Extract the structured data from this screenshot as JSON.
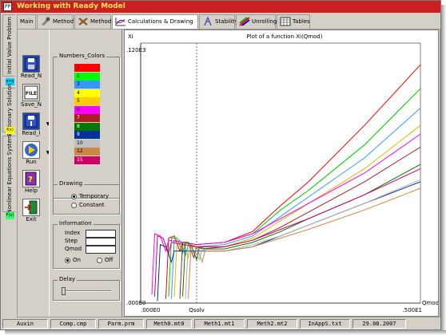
{
  "window": {
    "title": "Working with Ready Model",
    "icon_label": "PP"
  },
  "vertical_tabs": [
    {
      "label": "Initial Value Problem",
      "icon": "x-y-icon"
    },
    {
      "label": "Stationary Solution",
      "icon": "fx-icon"
    },
    {
      "label": "Nonlinear Equations System",
      "icon": "fx-matrix-icon"
    }
  ],
  "tabs": [
    {
      "label": "Main",
      "icon": ""
    },
    {
      "label": "Method1",
      "icon": "method1-icon"
    },
    {
      "label": "Method2",
      "icon": "method2-icon"
    },
    {
      "label": "Calculations & Drawing",
      "icon": "graph-icon",
      "active": true
    },
    {
      "label": "Stability",
      "icon": "stability-icon"
    },
    {
      "label": "Unrolling",
      "icon": "unrolling-icon"
    },
    {
      "label": "Tables",
      "icon": "tables-icon"
    }
  ],
  "toolbar": {
    "read_n": "Read_N",
    "save_n": "Save_N",
    "read_i": "Read_I",
    "run": "Run",
    "help": "Help",
    "exit": "Exit",
    "save_badge": "FILE"
  },
  "numbers_colors": {
    "title": "Numbers_Colors",
    "items": [
      {
        "label": "1",
        "color": "#ff0000"
      },
      {
        "label": "2",
        "color": "#00ff00"
      },
      {
        "label": "3",
        "color": "#3399ff"
      },
      {
        "label": "4",
        "color": "#ffff00"
      },
      {
        "label": "5",
        "color": "#ffcc00"
      },
      {
        "label": "6",
        "color": "#ff00ff"
      },
      {
        "label": "7",
        "color": "#aa2020"
      },
      {
        "label": "8",
        "color": "#007700"
      },
      {
        "label": "9",
        "color": "#003399"
      },
      {
        "label": "10",
        "color": "#c0c0c0"
      },
      {
        "label": "12",
        "color": "#cc8844"
      },
      {
        "label": "15",
        "color": "#cc0066"
      }
    ]
  },
  "drawing": {
    "title": "Drawing",
    "options": [
      "Temporary",
      "Constant"
    ],
    "selected": "Temporary"
  },
  "information": {
    "title": "Information",
    "fields": [
      {
        "label": "Index",
        "value": ""
      },
      {
        "label": "Step",
        "value": ""
      },
      {
        "label": "Qmod",
        "value": ""
      }
    ],
    "options": [
      "On",
      "Off"
    ],
    "selected": "On"
  },
  "delay": {
    "title": "Delay",
    "value": 0
  },
  "chart_data": {
    "type": "line",
    "title": "Plot of a function Xi(Qmod)",
    "ylabel": "Xi",
    "xlabel": "Qmod",
    "y_top_label": ".120E3",
    "y_bottom_label": ".000E0",
    "x_left_label": ".000E0",
    "x_right_label": ".500E1",
    "xlim": [
      0,
      5
    ],
    "ylim": [
      0,
      120
    ],
    "marker": {
      "label": "Qsolv",
      "x": 1.0
    },
    "grid": false,
    "series": [
      {
        "color": "#ff0000",
        "x": [
          0.45,
          0.5,
          0.6,
          0.7,
          0.75,
          1.0,
          1.5,
          2.0,
          2.5,
          3.0,
          4.0,
          5.0
        ],
        "y": [
          2,
          30,
          31,
          24,
          28,
          27,
          28,
          33,
          45,
          56,
          82,
          110
        ]
      },
      {
        "color": "#00cc00",
        "x": [
          0.5,
          0.55,
          0.65,
          0.75,
          0.8,
          1.0,
          1.5,
          2.0,
          2.5,
          3.0,
          4.0,
          5.0
        ],
        "y": [
          3,
          30,
          30,
          23,
          28,
          27,
          28,
          32,
          43,
          52,
          73,
          99
        ]
      },
      {
        "color": "#3399ff",
        "x": [
          0.55,
          0.6,
          0.7,
          0.8,
          0.85,
          1.0,
          1.5,
          2.0,
          2.5,
          3.0,
          4.0,
          5.0
        ],
        "y": [
          2,
          29,
          29,
          22,
          27,
          26,
          27,
          31,
          40,
          49,
          67,
          90
        ]
      },
      {
        "color": "#ddbb00",
        "x": [
          0.6,
          0.65,
          0.75,
          0.85,
          0.9,
          1.0,
          1.5,
          2.0,
          2.5,
          3.0,
          4.0,
          5.0
        ],
        "y": [
          3,
          29,
          28,
          21,
          27,
          26,
          26,
          30,
          38,
          46,
          62,
          82
        ]
      },
      {
        "color": "#ff00ff",
        "x": [
          0.2,
          0.25,
          0.35,
          0.45,
          0.5,
          1.0,
          1.5,
          2.0,
          2.5,
          3.0,
          4.0,
          5.0
        ],
        "y": [
          4,
          32,
          31,
          24,
          29,
          27,
          28,
          32,
          39,
          46,
          60,
          78
        ]
      },
      {
        "color": "#aa2020",
        "x": [
          0.7,
          0.75,
          0.85,
          0.95,
          1.0,
          1.1,
          1.5,
          2.0,
          2.5,
          3.0,
          4.0,
          5.0
        ],
        "y": [
          2,
          28,
          28,
          21,
          26,
          25,
          26,
          29,
          35,
          42,
          56,
          72
        ]
      },
      {
        "color": "#007700",
        "x": [
          0.75,
          0.8,
          0.9,
          1.0,
          1.05,
          1.15,
          1.5,
          2.0,
          2.5,
          3.0,
          4.0,
          5.0
        ],
        "y": [
          3,
          28,
          27,
          20,
          26,
          25,
          25,
          28,
          33,
          39,
          50,
          64
        ]
      },
      {
        "color": "#003399",
        "x": [
          0.3,
          0.35,
          0.45,
          0.55,
          0.6,
          1.0,
          1.5,
          2.0,
          2.5,
          3.0,
          4.0,
          5.0
        ],
        "y": [
          1,
          27,
          26,
          19,
          24,
          24,
          24,
          26,
          31,
          36,
          46,
          56
        ]
      },
      {
        "color": "#b0b0b0",
        "x": [
          0.8,
          0.85,
          0.95,
          1.05,
          1.1,
          1.2,
          1.5,
          2.0,
          2.5,
          3.0,
          4.0,
          5.0
        ],
        "y": [
          2,
          27,
          27,
          20,
          25,
          24,
          24,
          27,
          31,
          36,
          46,
          57
        ]
      },
      {
        "color": "#cc8844",
        "x": [
          0.85,
          0.9,
          1.0,
          1.1,
          1.15,
          1.25,
          1.5,
          2.0,
          2.5,
          3.0,
          4.0,
          5.0
        ],
        "y": [
          2,
          26,
          26,
          19,
          24,
          24,
          24,
          26,
          30,
          34,
          43,
          53
        ]
      },
      {
        "color": "#cc0066",
        "x": [
          0.25,
          0.3,
          0.4,
          0.5,
          0.55,
          1.0,
          1.5,
          2.0,
          2.5,
          3.0,
          4.0,
          5.0
        ],
        "y": [
          3,
          31,
          30,
          23,
          28,
          26,
          26,
          29,
          34,
          39,
          50,
          62
        ]
      }
    ]
  },
  "status_bar": [
    "Auxin",
    "Comp.cmp",
    "Parm.prm",
    "Meth0.mt0",
    "Meth1.mt1",
    "Meth2.mt2",
    "InAppS.txt",
    "29.08.2007"
  ]
}
